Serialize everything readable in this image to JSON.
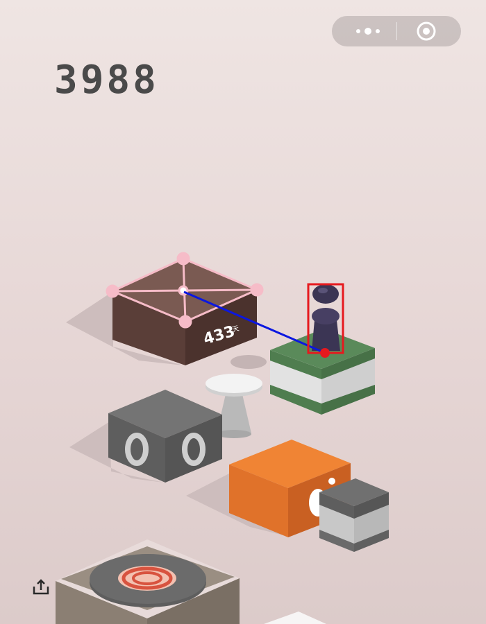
{
  "hud": {
    "score": "3988",
    "menu_button": {
      "icon": "more-dots-icon"
    },
    "close_button": {
      "icon": "target-circle-icon"
    },
    "share_button": {
      "icon": "share-icon"
    }
  },
  "scene": {
    "platform_label": "433",
    "platform_label_suffix": "天",
    "colors": {
      "current_platform_top": "#5a8a5a",
      "current_platform_side": "#e4e4e4",
      "target_platform": "#5a3a32",
      "piece": "#3b3554",
      "orange_cube": "#f08030",
      "gray_cube": "#6b6b6b",
      "overlay_bbox": "#e6191e",
      "overlay_line": "#0b17e0",
      "overlay_wireframe": "#f6bcc8"
    }
  }
}
